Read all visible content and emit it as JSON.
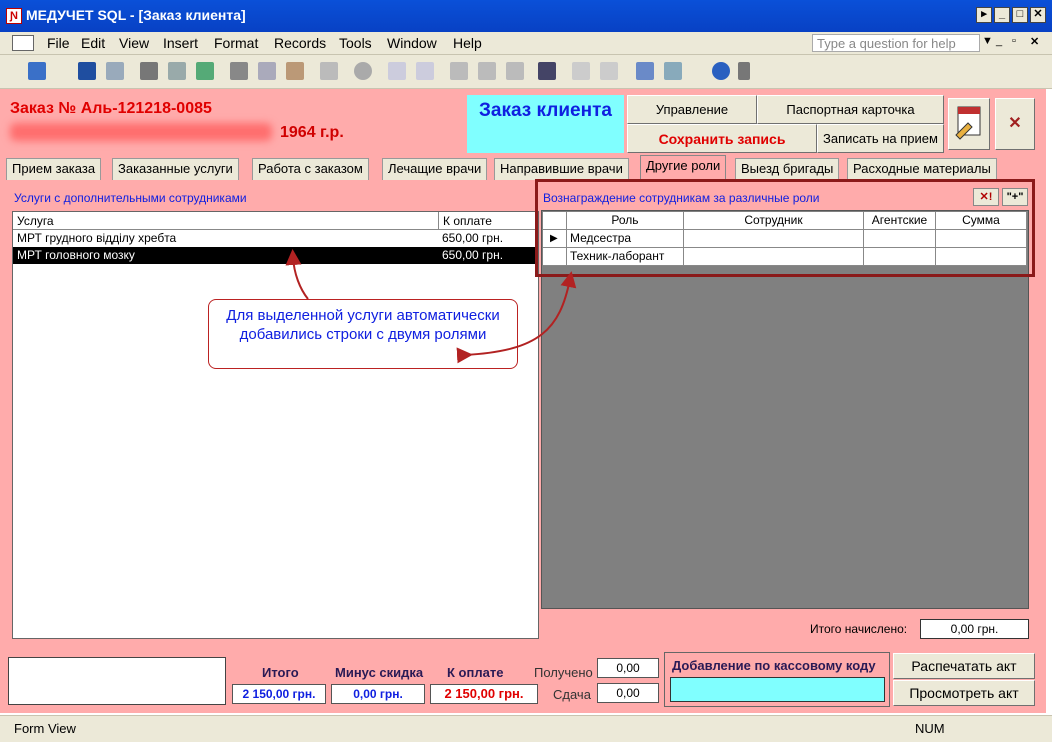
{
  "window": {
    "title": "МЕДУЧЕТ SQL - [Заказ клиента]",
    "icon_letter": "Ɲ"
  },
  "menu": {
    "items": [
      "File",
      "Edit",
      "View",
      "Insert",
      "Format",
      "Records",
      "Tools",
      "Window",
      "Help"
    ],
    "help_placeholder": "Type a question for help"
  },
  "header": {
    "order_label": "Заказ №  Аль-121218-0085",
    "birth_year": "1964 г.р.",
    "form_title": "Заказ клиента",
    "buttons": {
      "manage": "Управление",
      "passport": "Паспортная карточка",
      "save": "Сохранить запись",
      "appointment": "Записать на прием"
    }
  },
  "tabs": [
    "Прием заказа",
    "Заказанные услуги",
    "Работа с заказом",
    "Лечащие врачи",
    "Направившие врачи",
    "Другие роли",
    "Выезд бригады",
    "Расходные материалы"
  ],
  "active_tab": "Другие роли",
  "left_panel": {
    "caption": "Услуги с дополнительными сотрудниками",
    "columns": [
      "Услуга",
      "К оплате"
    ],
    "rows": [
      {
        "service": "МРТ грудного відділу хребта",
        "amount": "650,00 грн."
      },
      {
        "service": "МРТ головного мозку",
        "amount": "650,00 грн."
      }
    ]
  },
  "right_panel": {
    "caption": "Вознаграждение сотрудникам за различные роли",
    "delete_btn": "✕!",
    "add_btn": "\"+\"",
    "columns": [
      "Роль",
      "Сотрудник",
      "Агентские",
      "Сумма"
    ],
    "rows": [
      {
        "role": "Медсестра",
        "employee": "",
        "agency": "",
        "sum": ""
      },
      {
        "role": "Техник-лаборант",
        "employee": "",
        "agency": "",
        "sum": ""
      }
    ],
    "total_label": "Итого начислено:",
    "total_value": "0,00 грн."
  },
  "callout": {
    "text": "Для выделенной услуги автоматически добавились строки с двумя ролями"
  },
  "footer": {
    "total_label": "Итого",
    "total_value": "2 150,00 грн.",
    "discount_label": "Минус скидка",
    "discount_value": "0,00 грн.",
    "pay_label": "К оплате",
    "pay_value": "2 150,00 грн.",
    "received_label": "Получено",
    "received_value": "0,00",
    "change_label": "Сдача",
    "change_value": "0,00",
    "cash_code_label": "Добавление по кассовому коду",
    "print_act": "Распечатать акт",
    "view_act": "Просмотреть акт"
  },
  "status": {
    "mode": "Form View",
    "num": "NUM"
  },
  "colors": {
    "form_bg": "#ffabab",
    "title_box": "#80ffff",
    "accent_red": "#e00000",
    "accent_blue": "#1020e0",
    "callout_border": "#b22222"
  }
}
